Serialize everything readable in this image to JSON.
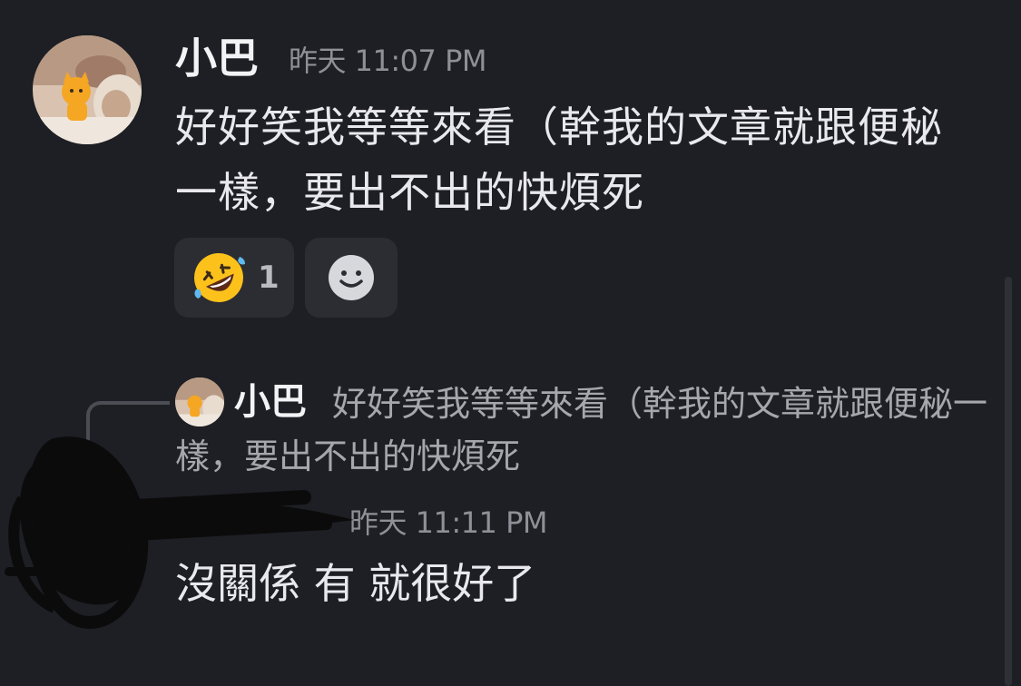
{
  "message1": {
    "author": "小巴",
    "timestamp": "昨天 11:07 PM",
    "text": "好好笑我等等來看（幹我的文章就跟便秘一樣，要出不出的快煩死"
  },
  "reactions": [
    {
      "emoji_icon": "rolling-on-floor-laughing-emoji",
      "count": "1"
    },
    {
      "emoji_icon": "add-reaction-smiley-icon"
    }
  ],
  "reply": {
    "author": "小巴",
    "preview": "好好笑我等等來看（幹我的文章就跟便秘一樣，要出不出的快煩死"
  },
  "message2": {
    "timestamp": "昨天 11:11 PM",
    "text": "沒關係 有 就很好了"
  },
  "colors": {
    "background": "#1e1f24",
    "reaction_bg": "#2b2d33",
    "timestamp": "#8e9097"
  }
}
